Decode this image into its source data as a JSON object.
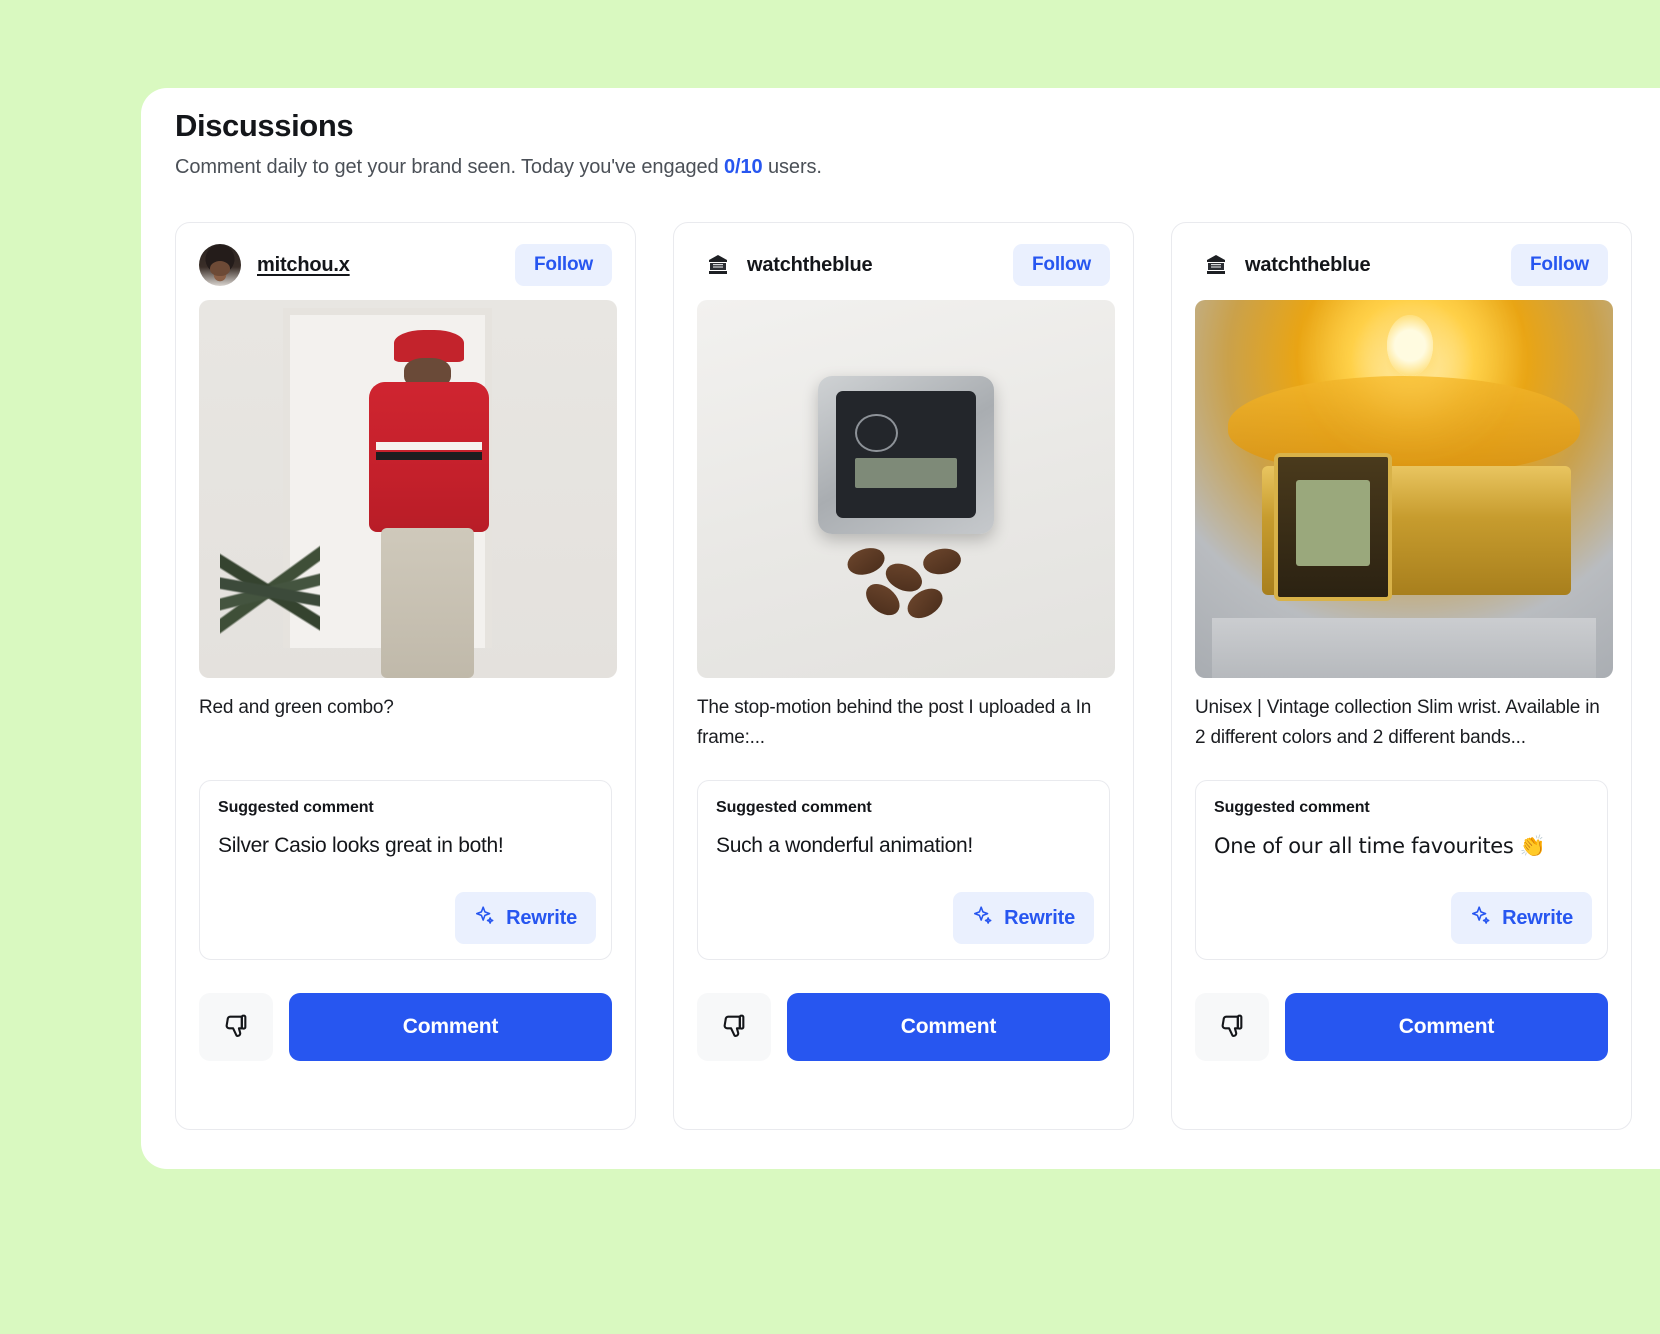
{
  "header": {
    "title": "Discussions",
    "subtitle_before": "Comment daily to get your brand seen. Today you've engaged ",
    "engaged_count": "0/10",
    "subtitle_after": " users."
  },
  "labels": {
    "suggested_comment": "Suggested comment",
    "follow": "Follow",
    "rewrite": "Rewrite",
    "comment": "Comment"
  },
  "colors": {
    "page_background": "#d9f9c0",
    "panel_background": "#ffffff",
    "accent_blue": "#2756f0",
    "accent_blue_soft": "#eaf0fe",
    "card_border": "#e9eaee",
    "text_primary": "#14161a",
    "text_secondary": "#4b5057"
  },
  "cards": [
    {
      "username": "mitchou.x",
      "avatar_type": "photo-avatar",
      "follow_label": "Follow",
      "media_alt": "person-in-red-jacket-photo",
      "caption": "Red and green combo?",
      "suggested_label": "Suggested comment",
      "suggested_text": "Silver Casio looks great in both!",
      "rewrite_label": "Rewrite",
      "comment_label": "Comment"
    },
    {
      "username": "watchtheblue",
      "avatar_type": "logo-avatar",
      "follow_label": "Follow",
      "media_alt": "casio-watch-with-coffee-beans-photo",
      "caption": "The stop-motion behind the post I uploaded a In frame:...",
      "suggested_label": "Suggested comment",
      "suggested_text": "Such a wonderful animation!",
      "rewrite_label": "Rewrite",
      "comment_label": "Comment"
    },
    {
      "username": "watchtheblue",
      "avatar_type": "logo-avatar",
      "follow_label": "Follow",
      "media_alt": "gold-vintage-watch-under-lamp-photo",
      "caption": "Unisex | Vintage collection Slim wrist. Available in 2 different colors and 2 different bands...",
      "suggested_label": "Suggested comment",
      "suggested_text": "One of our all time favourites 👏",
      "rewrite_label": "Rewrite",
      "comment_label": "Comment"
    }
  ]
}
